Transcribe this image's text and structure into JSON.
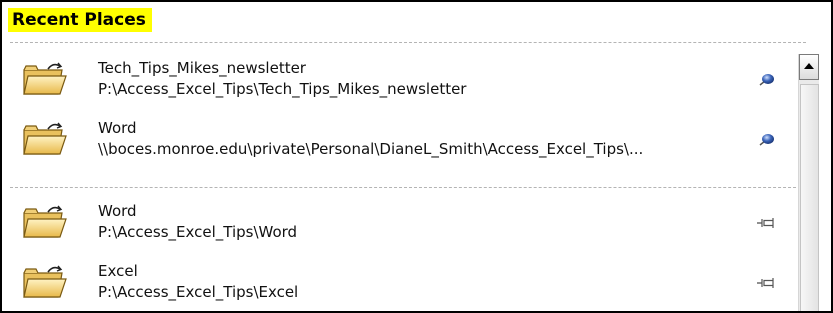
{
  "header": {
    "title": "Recent Places"
  },
  "pinned": [
    {
      "title": "Tech_Tips_Mikes_newsletter",
      "path": "P:\\Access_Excel_Tips\\Tech_Tips_Mikes_newsletter",
      "icon": "pinned-icon"
    },
    {
      "title": "Word",
      "path": "\\\\boces.monroe.edu\\private\\Personal\\DianeL_Smith\\Access_Excel_Tips\\...",
      "icon": "pinned-icon"
    }
  ],
  "recent": [
    {
      "title": "Word",
      "path": "P:\\Access_Excel_Tips\\Word",
      "icon": "unpinned-pushpin-icon"
    },
    {
      "title": "Excel",
      "path": "P:\\Access_Excel_Tips\\Excel",
      "icon": "unpinned-pushpin-icon"
    }
  ],
  "colors": {
    "header_highlight": "#ffff00",
    "folder": "#f3d270",
    "pin_head": "#3a63b8"
  }
}
